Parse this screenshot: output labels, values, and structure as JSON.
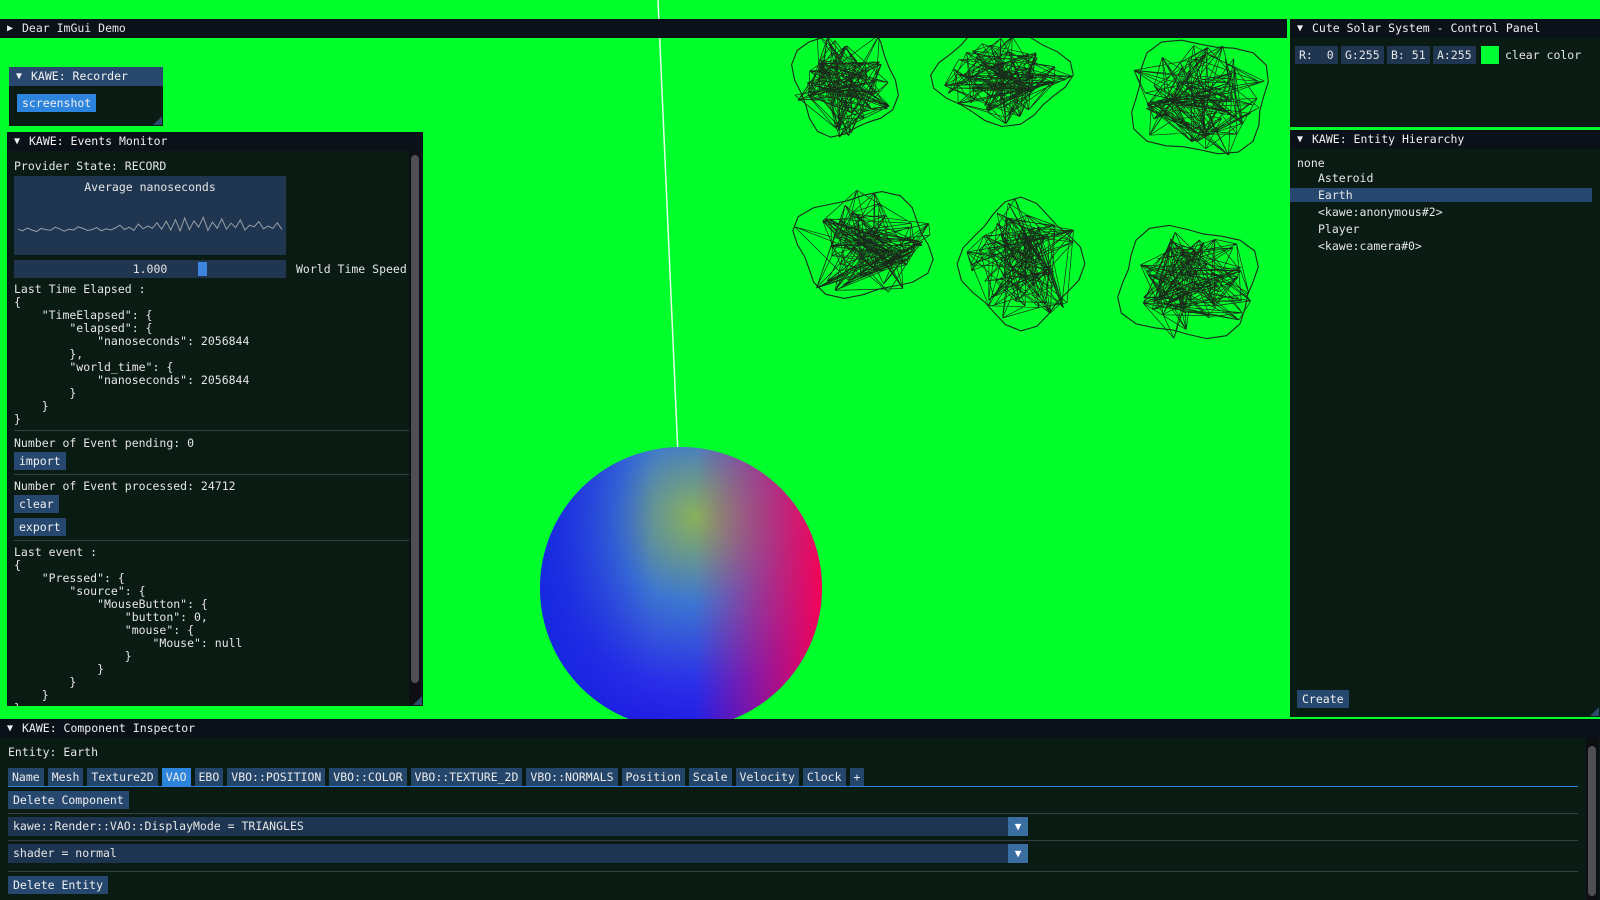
{
  "demo_bar": {
    "arrow": "▶",
    "title": "Dear ImGui Demo"
  },
  "recorder": {
    "arrow": "▼",
    "title": "KAWE: Recorder",
    "screenshot_label": "screenshot"
  },
  "events": {
    "arrow": "▼",
    "title": "KAWE: Events Monitor",
    "provider_state": "Provider State: RECORD",
    "plot_title": "Average nanoseconds",
    "plot_values": [
      0.42,
      0.38,
      0.45,
      0.4,
      0.36,
      0.44,
      0.41,
      0.39,
      0.47,
      0.43,
      0.37,
      0.42,
      0.4,
      0.48,
      0.44,
      0.39,
      0.41,
      0.46,
      0.38,
      0.43,
      0.4,
      0.45,
      0.52,
      0.41,
      0.47,
      0.39,
      0.55,
      0.43,
      0.5,
      0.44,
      0.58,
      0.42,
      0.62,
      0.4,
      0.66,
      0.38,
      0.7,
      0.41,
      0.63,
      0.47,
      0.72,
      0.39,
      0.6,
      0.44,
      0.68,
      0.42,
      0.57,
      0.46,
      0.65,
      0.4,
      0.52,
      0.48,
      0.61,
      0.43,
      0.5,
      0.44,
      0.58,
      0.41
    ],
    "speed_value": "1.000",
    "speed_fraction": 0.7,
    "speed_label": "World Time Speed",
    "last_elapsed_label": "Last Time Elapsed :",
    "elapsed_json": "{\n    \"TimeElapsed\": {\n        \"elapsed\": {\n            \"nanoseconds\": 2056844\n        },\n        \"world_time\": {\n            \"nanoseconds\": 2056844\n        }\n    }\n}",
    "pending_label": "Number of Event pending: 0",
    "import_label": "import",
    "processed_label": "Number of Event processed: 24712",
    "clear_label": "clear",
    "export_label": "export",
    "last_event_label": "Last event :",
    "event_json": "{\n    \"Pressed\": {\n        \"source\": {\n            \"MouseButton\": {\n                \"button\": 0,\n                \"mouse\": {\n                    \"Mouse\": null\n                }\n            }\n        }\n    }\n}"
  },
  "control": {
    "arrow": "▼",
    "title": "Cute Solar System - Control Panel",
    "r": "R:  0",
    "g": "G:255",
    "b": "B: 51",
    "a": "A:255",
    "swatch": "#00ff33",
    "clear_label": "clear color"
  },
  "hierarchy": {
    "arrow": "▼",
    "title": "KAWE: Entity Hierarchy",
    "root": "none",
    "items": [
      "Asteroid",
      "Earth",
      "<kawe:anonymous#2>",
      "Player",
      "<kawe:camera#0>"
    ],
    "selected_index": 1,
    "create_label": "Create"
  },
  "inspector": {
    "arrow": "▼",
    "title": "KAWE: Component Inspector",
    "entity_label": "Entity: Earth",
    "tabs": [
      "Name",
      "Mesh",
      "Texture2D",
      "VAO",
      "EBO",
      "VBO::POSITION",
      "VBO::COLOR",
      "VBO::TEXTURE_2D",
      "VBO::NORMALS",
      "Position",
      "Scale",
      "Velocity",
      "Clock",
      "+"
    ],
    "selected_tab": 3,
    "delete_component_label": "Delete Component",
    "display_mode": "kawe::Render::VAO::DisplayMode = TRIANGLES",
    "shader": "shader = normal",
    "combo_arrow": "▼",
    "delete_entity_label": "Delete Entity"
  },
  "scene": {
    "background": "#00ff2b",
    "sphere": "earth-sphere",
    "asteroid_count": 6
  }
}
